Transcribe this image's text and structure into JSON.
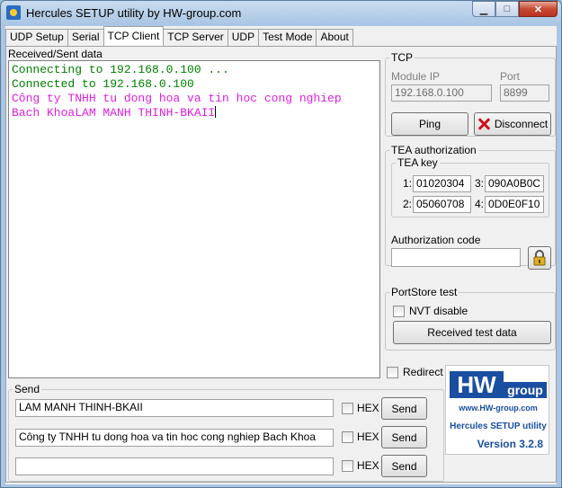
{
  "window": {
    "title": "Hercules SETUP utility by HW-group.com",
    "minimize": "▁",
    "maximize": "□",
    "close": "✕"
  },
  "tabs": [
    "UDP Setup",
    "Serial",
    "TCP Client",
    "TCP Server",
    "UDP",
    "Test Mode",
    "About"
  ],
  "log": {
    "label": "Received/Sent data",
    "lines": [
      {
        "text": "Connecting to 192.168.0.100 ...",
        "color": "#008000"
      },
      {
        "text": "Connected to 192.168.0.100",
        "color": "#008000"
      },
      {
        "text": "Công ty TNHH tu dong hoa va tin hoc cong nghiep",
        "color": "#e020e0"
      },
      {
        "text": "Bach KhoaLAM MANH THINH-BKAII",
        "color": "#e020e0"
      }
    ]
  },
  "tcp": {
    "legend": "TCP",
    "module_ip_label": "Module IP",
    "module_ip": "192.168.0.100",
    "port_label": "Port",
    "port": "8899",
    "ping": "Ping",
    "disconnect": "Disconnect"
  },
  "tea": {
    "legend": "TEA authorization",
    "key_legend": "TEA key",
    "keys": [
      {
        "n": "1:",
        "v": "01020304"
      },
      {
        "n": "3:",
        "v": "090A0B0C"
      },
      {
        "n": "2:",
        "v": "05060708"
      },
      {
        "n": "4:",
        "v": "0D0E0F10"
      }
    ],
    "auth_label": "Authorization code",
    "auth_value": ""
  },
  "portstore": {
    "legend": "PortStore test",
    "nvt_disable": "NVT disable",
    "received_test_data": "Received test data"
  },
  "redirect_udp": "Redirect to UDP",
  "send": {
    "legend": "Send",
    "rows": [
      {
        "value": "LAM MANH THINH-BKAII",
        "hex": "HEX",
        "button": "Send"
      },
      {
        "value": "Công ty TNHH tu dong hoa va tin hoc cong nghiep Bach Khoa",
        "hex": "HEX",
        "button": "Send"
      },
      {
        "value": "",
        "hex": "HEX",
        "button": "Send"
      }
    ]
  },
  "logo": {
    "hw": "HW",
    "group": "group",
    "url": "www.HW-group.com",
    "name": "Hercules SETUP utility",
    "version": "Version  3.2.8"
  }
}
